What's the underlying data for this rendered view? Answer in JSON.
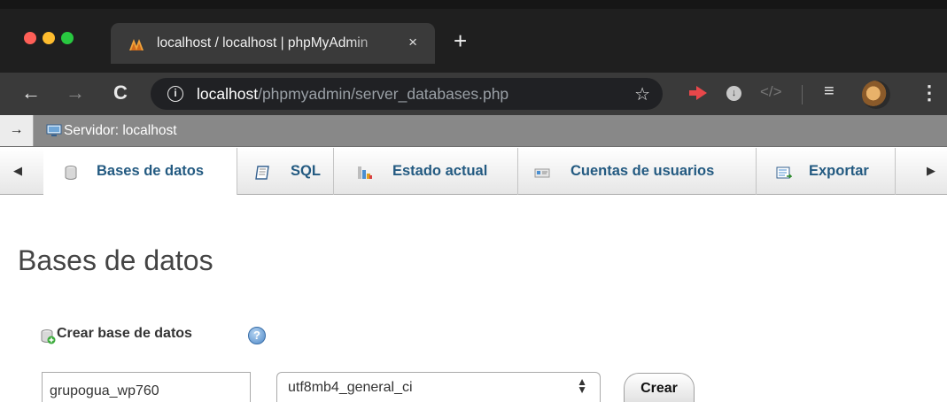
{
  "browser": {
    "tab_title": "localhost / localhost | phpMyAdmin",
    "tab_close": "×",
    "new_tab": "+",
    "url_host": "localhost",
    "url_path": "/phpmyadmin/server_databases.php"
  },
  "breadcrumb": {
    "toggle": "→",
    "server_label": "Servidor: localhost"
  },
  "menu": {
    "tabs": [
      {
        "label": "Bases de datos",
        "icon": "database-icon",
        "active": true
      },
      {
        "label": "SQL",
        "icon": "sql-icon",
        "active": false
      },
      {
        "label": "Estado actual",
        "icon": "status-chart-icon",
        "active": false
      },
      {
        "label": "Cuentas de usuarios",
        "icon": "user-accounts-icon",
        "active": false
      },
      {
        "label": "Exportar",
        "icon": "export-icon",
        "active": false
      }
    ]
  },
  "page": {
    "title": "Bases de datos"
  },
  "create_db": {
    "label": "Crear base de datos",
    "db_name_value": "grupogua_wp760",
    "collation_value": "utf8mb4_general_ci",
    "button_label": "Crear"
  },
  "colors": {
    "link": "#235a81",
    "serverbar": "#888888",
    "chrome_dark": "#1f1f1f"
  }
}
